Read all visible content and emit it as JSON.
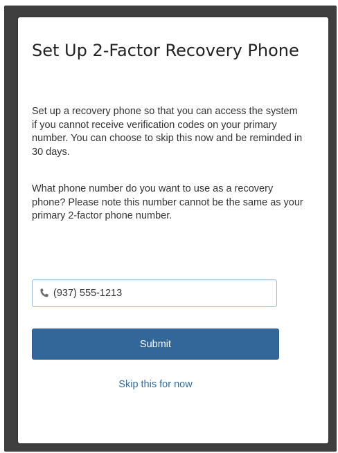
{
  "dialog": {
    "title": "Set Up 2-Factor Recovery Phone",
    "intro": "Set up a recovery phone so that you can access the system if you cannot receive verification codes on your primary number. You can choose to skip this now and be reminded in 30 days.",
    "question": "What phone number do you want to use as a recovery phone? Please note this number cannot be the same as your primary 2-factor phone number.",
    "phone_input": {
      "value": "(937) 555-1213",
      "icon": "phone-icon"
    },
    "submit_label": "Submit",
    "skip_label": "Skip this for now"
  },
  "colors": {
    "backdrop": "#3f3f3f",
    "primary_button": "#336699",
    "link": "#2e6da4",
    "input_border": "#9dbcd8"
  }
}
